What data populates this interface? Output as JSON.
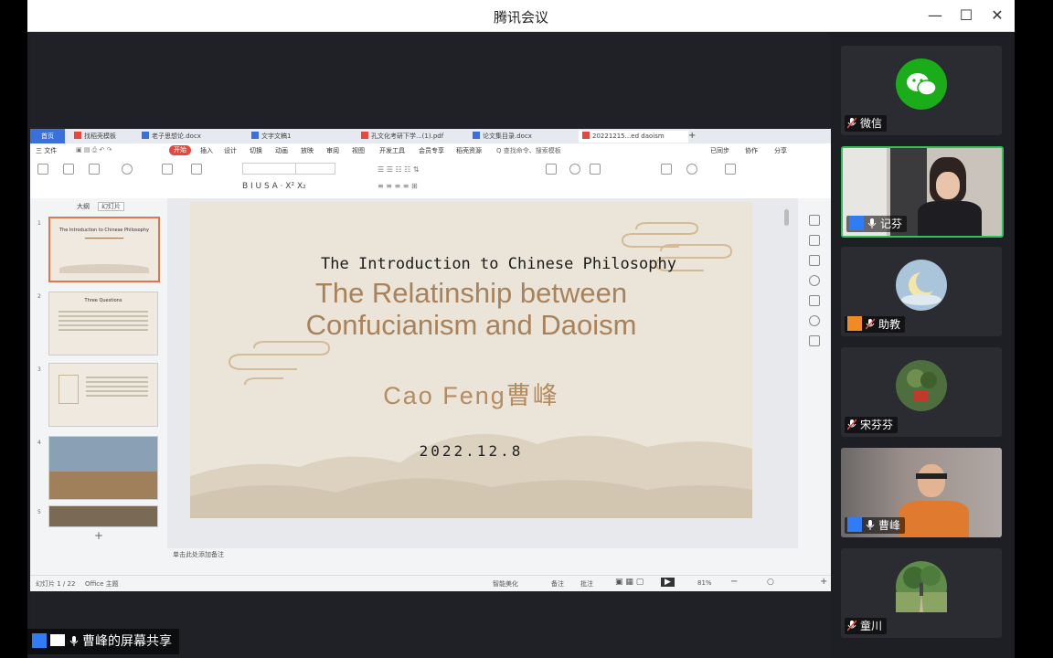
{
  "window": {
    "title": "腾讯会议"
  },
  "wps": {
    "tabs": [
      {
        "label": "首页",
        "active": false
      },
      {
        "label": "找稻壳模板",
        "active": false
      },
      {
        "label": "老子思想论.docx",
        "active": false
      },
      {
        "label": "文字文稿1",
        "active": false
      },
      {
        "label": "孔文化考研下学...(1).pdf",
        "active": false
      },
      {
        "label": "论文集目录.docx",
        "active": false
      },
      {
        "label": "20221215...ed daoism",
        "active": true
      }
    ],
    "menu": {
      "file": "三 文件",
      "start": "开始",
      "items": [
        "插入",
        "设计",
        "切换",
        "动画",
        "放映",
        "审阅",
        "视图",
        "开发工具",
        "会员专享",
        "稻壳资源"
      ],
      "search": "Q 查找命令、搜索模板",
      "right": [
        "已同步",
        "协作",
        "分享"
      ]
    },
    "thumbs_tabs": [
      "大纲",
      "幻灯片"
    ],
    "slide": {
      "subtitle": "The Introduction to Chinese Philosophy",
      "title_line1": "The Relatinship between",
      "title_line2": "Confucianism and Daoism",
      "author": "Cao Feng曹峰",
      "date": "2022.12.8"
    },
    "thumbs": [
      {
        "num": "1",
        "text": "The Introduction to Chinese Philosophy"
      },
      {
        "num": "2",
        "text": "Three Questions"
      },
      {
        "num": "3",
        "text": ""
      },
      {
        "num": "4",
        "text": ""
      },
      {
        "num": "5",
        "text": ""
      }
    ],
    "notes_placeholder": "单击此处添加备注",
    "status": {
      "page": "幻灯片 1 / 22",
      "theme": "Office 主题",
      "beautify": "智能美化",
      "notes": "备注",
      "comments": "批注",
      "zoom": "81%"
    }
  },
  "participants": [
    {
      "name": "微信",
      "mic_off": true,
      "speaking": false
    },
    {
      "name": "记芬",
      "mic_off": false,
      "speaking": true
    },
    {
      "name": "助教",
      "mic_off": true,
      "speaking": false
    },
    {
      "name": "宋芬芬",
      "mic_off": true,
      "speaking": false
    },
    {
      "name": "曹峰",
      "mic_off": false,
      "speaking": false
    },
    {
      "name": "童川",
      "mic_off": true,
      "speaking": false
    }
  ],
  "share_bar": {
    "label": "曹峰的屏幕共享"
  },
  "colors": {
    "accent_green": "#2fc25b",
    "slide_gold": "#a8825a",
    "wechat_green": "#1aad19",
    "wps_red": "#e8473d"
  }
}
